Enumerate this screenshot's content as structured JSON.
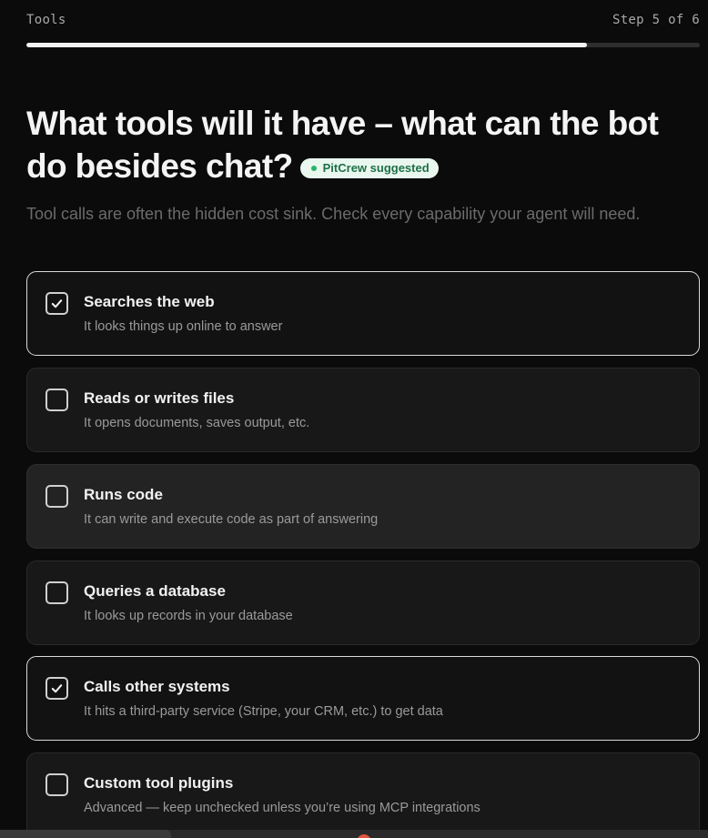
{
  "header": {
    "section": "Tools",
    "step": "Step 5 of 6",
    "progress_fraction": 0.833
  },
  "headline": {
    "text": "What tools will it have – what can the bot do besides chat?",
    "badge": "PitCrew suggested"
  },
  "subtext": "Tool calls are often the hidden cost sink. Check every capability your agent will need.",
  "options": [
    {
      "title": "Searches the web",
      "desc": "It looks things up online to answer",
      "checked": true
    },
    {
      "title": "Reads or writes files",
      "desc": "It opens documents, saves output, etc.",
      "checked": false
    },
    {
      "title": "Runs code",
      "desc": "It can write and execute code as part of answering",
      "checked": false
    },
    {
      "title": "Queries a database",
      "desc": "It looks up records in your database",
      "checked": false
    },
    {
      "title": "Calls other systems",
      "desc": "It hits a third-party service (Stripe, your CRM, etc.) to get data",
      "checked": true
    },
    {
      "title": "Custom tool plugins",
      "desc": "Advanced — keep unchecked unless you’re using MCP integrations",
      "checked": false
    }
  ],
  "colors": {
    "background": "#0b0b0b",
    "badge_bg": "#e9f7ef",
    "badge_dot": "#2bb36a",
    "badge_text": "#1f6f46"
  },
  "icons": {
    "checkbox_checked": "check-icon",
    "badge_dot": "status-dot-icon"
  }
}
